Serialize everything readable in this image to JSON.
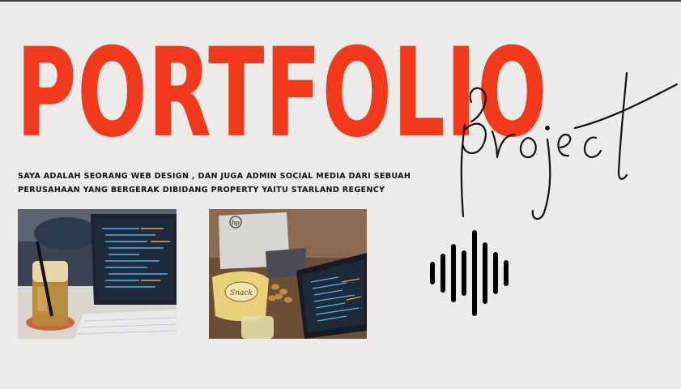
{
  "hero": {
    "title": "PORTFOLIO",
    "script_word": "project"
  },
  "description": {
    "line1": "SAYA ADALAH SEORANG WEB DESIGN , DAN JUGA ADMIN SOCIAL MEDIA DARI SEBUAH",
    "line2": "PERUSAHAAN YANG BERGERAK DIBIDANG PROPERTY YAITU STARLAND REGENCY"
  },
  "photos": [
    {
      "name": "laptop-with-iced-drink",
      "subject": "laptop with code editor and iced drink"
    },
    {
      "name": "laptop-with-snacks",
      "subject": "hp laptop, code editor and snack package"
    }
  ],
  "photo_text": {
    "snack_label": "Snack",
    "laptop_brand": "hp"
  },
  "icons": {
    "sound_wave": "sound-wave-icon"
  },
  "colors": {
    "background": "#ecebe9",
    "accent": "#f2391c",
    "text": "#111111"
  }
}
